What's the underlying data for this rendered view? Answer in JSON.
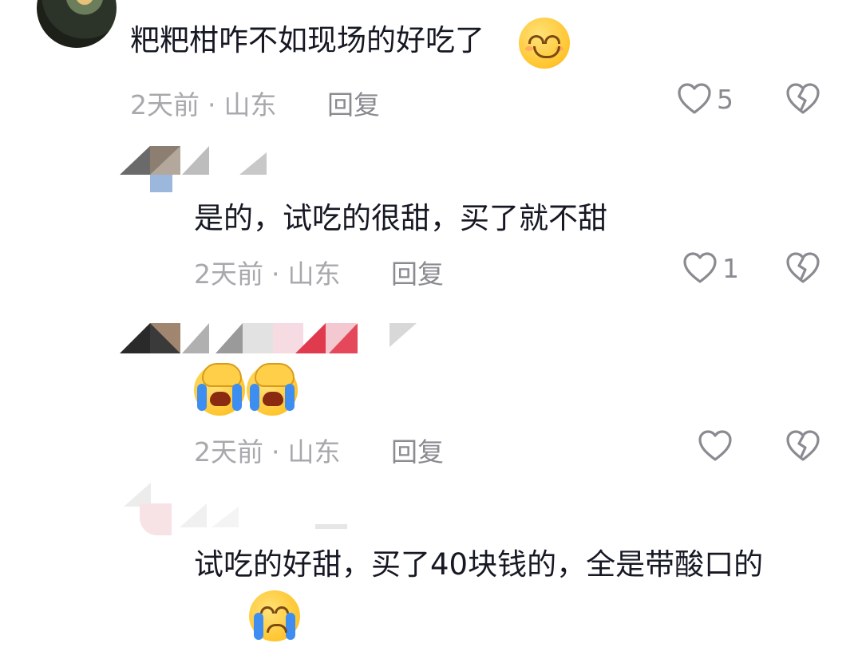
{
  "comments": [
    {
      "author": "",
      "text": "粑粑柑咋不如现场的好吃了",
      "emoji": "smiling-face",
      "time": "2天前",
      "location": "山东",
      "reply_label": "回复",
      "likes": "5"
    },
    {
      "author": "",
      "text": "是的，试吃的很甜，买了就不甜",
      "time": "2天前",
      "location": "山东",
      "reply_label": "回复",
      "likes": "1"
    },
    {
      "author": "",
      "text": "",
      "emoji": "facepalm-crying x2",
      "time": "2天前",
      "location": "山东",
      "reply_label": "回复",
      "likes": ""
    },
    {
      "author": "",
      "text": "试吃的好甜，买了40块钱的，全是带酸口的",
      "emoji": "crying-face"
    }
  ],
  "meta_separator": "·",
  "icons": {
    "like": "heart-outline-icon",
    "dislike": "broken-heart-icon"
  },
  "colors": {
    "text": "#161823",
    "meta": "#a8a8ad",
    "icon": "#8a8a90"
  }
}
